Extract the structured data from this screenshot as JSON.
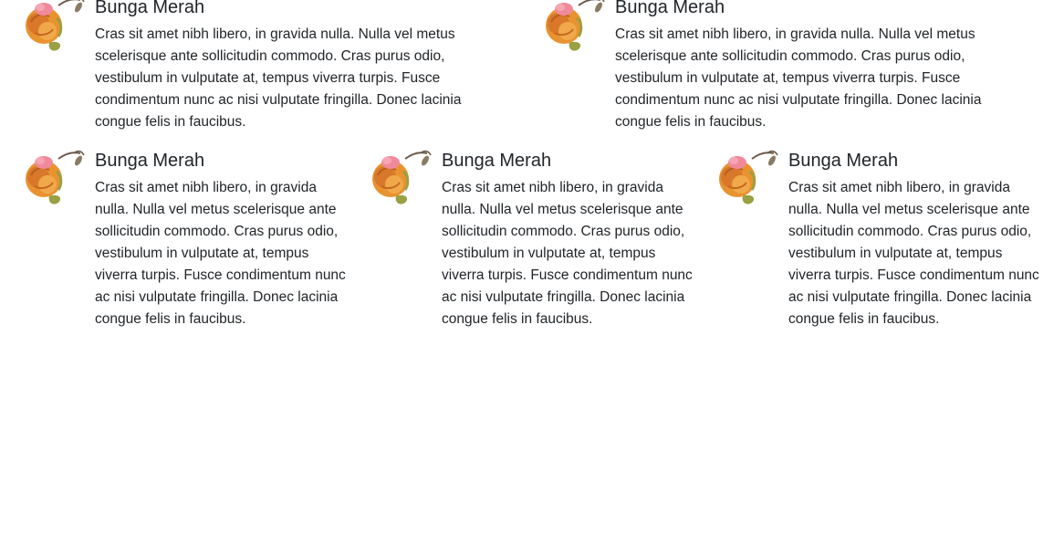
{
  "items": [
    {
      "title": "Bunga Merah",
      "text": "Cras sit amet nibh libero, in gravida nulla. Nulla vel metus scelerisque ante sollicitudin commodo. Cras purus odio, vestibulum in vulputate at, tempus viverra turpis. Fusce condimentum nunc ac nisi vulputate fringilla. Donec lacinia congue felis in faucibus.",
      "image_icon": "orange-rose-icon"
    },
    {
      "title": "Bunga Merah",
      "text": "Cras sit amet nibh libero, in gravida nulla. Nulla vel metus scelerisque ante sollicitudin commodo. Cras purus odio, vestibulum in vulputate at, tempus viverra turpis. Fusce condimentum nunc ac nisi vulputate fringilla. Donec lacinia congue felis in faucibus.",
      "image_icon": "orange-rose-icon"
    },
    {
      "title": "Bunga Merah",
      "text": "Cras sit amet nibh libero, in gravida nulla. Nulla vel metus scelerisque ante sollicitudin commodo. Cras purus odio, vestibulum in vulputate at, tempus viverra turpis. Fusce condimentum nunc ac nisi vulputate fringilla. Donec lacinia congue felis in faucibus.",
      "image_icon": "orange-rose-icon"
    },
    {
      "title": "Bunga Merah",
      "text": "Cras sit amet nibh libero, in gravida nulla. Nulla vel metus scelerisque ante sollicitudin commodo. Cras purus odio, vestibulum in vulputate at, tempus viverra turpis. Fusce condimentum nunc ac nisi vulputate fringilla. Donec lacinia congue felis in faucibus.",
      "image_icon": "orange-rose-icon"
    },
    {
      "title": "Bunga Merah",
      "text": "Cras sit amet nibh libero, in gravida nulla. Nulla vel metus scelerisque ante sollicitudin commodo. Cras purus odio, vestibulum in vulputate at, tempus viverra turpis. Fusce condimentum nunc ac nisi vulputate fringilla. Donec lacinia congue felis in faucibus.",
      "image_icon": "orange-rose-icon"
    }
  ],
  "colors": {
    "text": "#212529",
    "rose_orange": "#e8932f",
    "rose_pink": "#f08a9a",
    "leaf": "#9aa043"
  }
}
